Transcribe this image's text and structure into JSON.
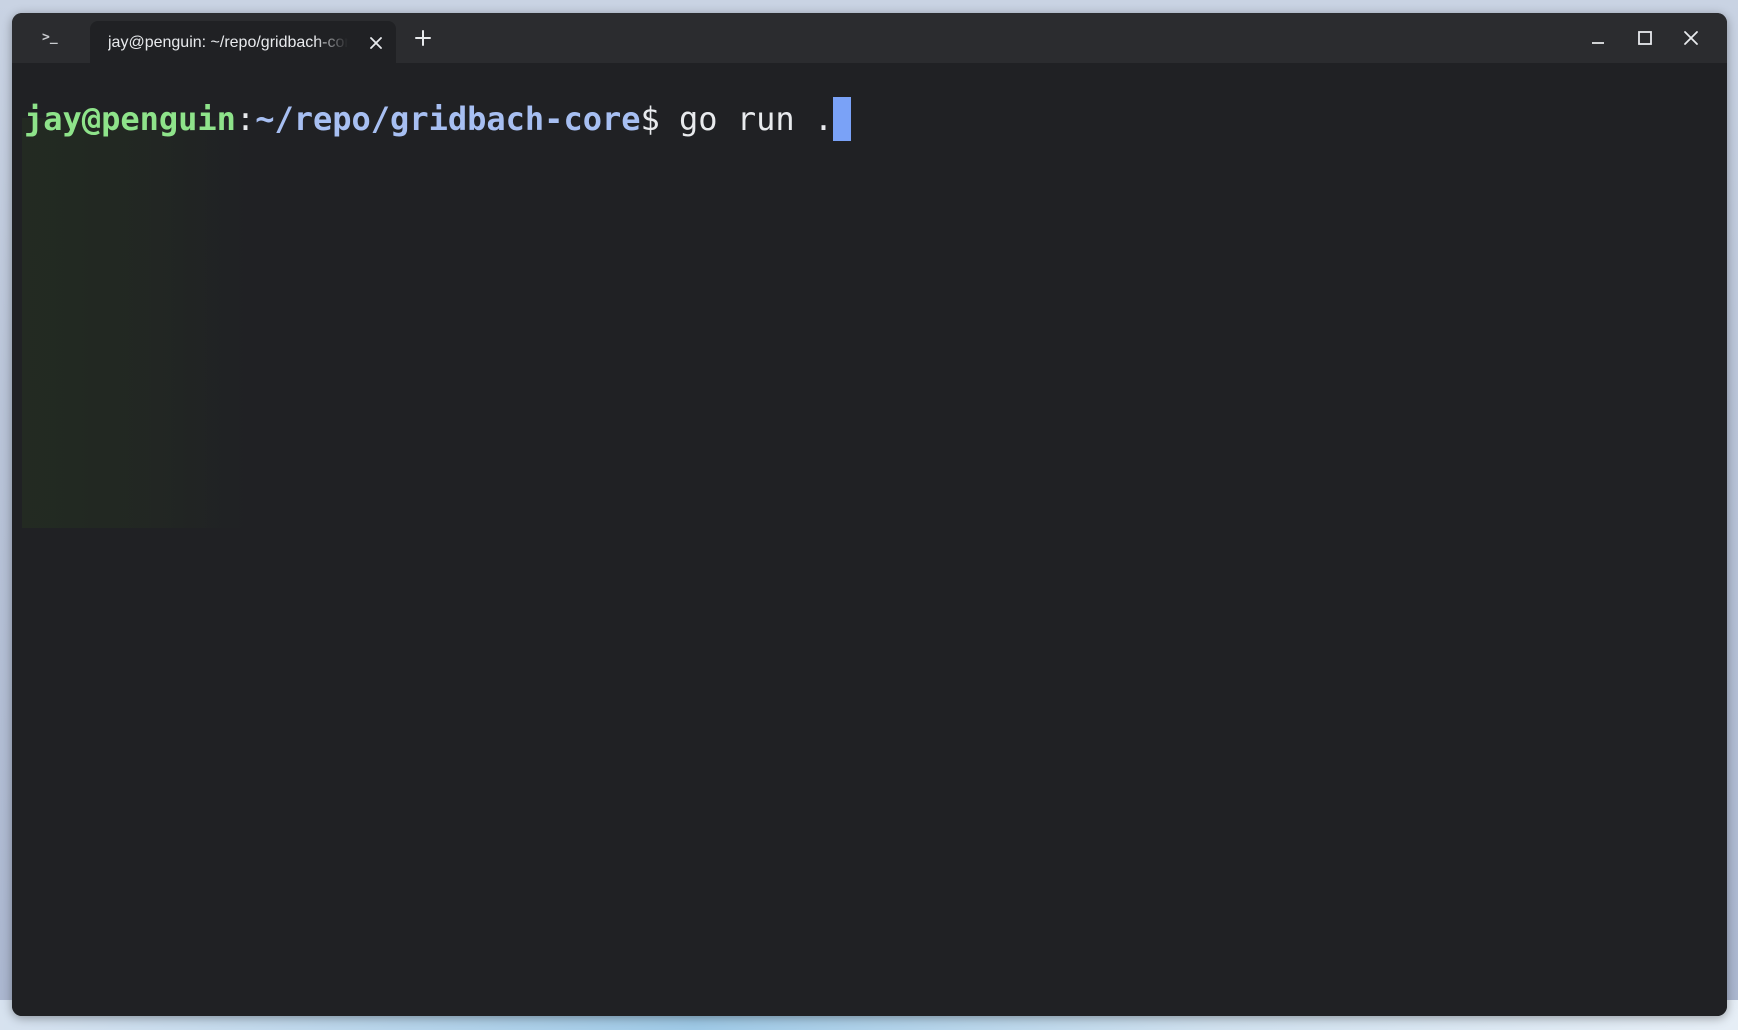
{
  "app": {
    "tab_title": "jay@penguin: ~/repo/gridbach-core",
    "app_icon": "terminal-icon",
    "new_tab_icon": "plus-icon",
    "tab_close_icon": "close-icon"
  },
  "window_controls": {
    "minimize_icon": "minimize-icon",
    "maximize_icon": "maximize-icon",
    "close_icon": "close-icon"
  },
  "terminal": {
    "prompt_user_host": "jay@penguin",
    "prompt_colon": ":",
    "prompt_path": "~/repo/gridbach-core",
    "prompt_symbol": "$",
    "command": " go run ."
  },
  "colors": {
    "background": "#202124",
    "titlebar": "#2b2c2f",
    "prompt_user": "#8ee38a",
    "prompt_path": "#a7bff2",
    "cursor": "#7aa2f7",
    "text": "#e8eaed"
  }
}
